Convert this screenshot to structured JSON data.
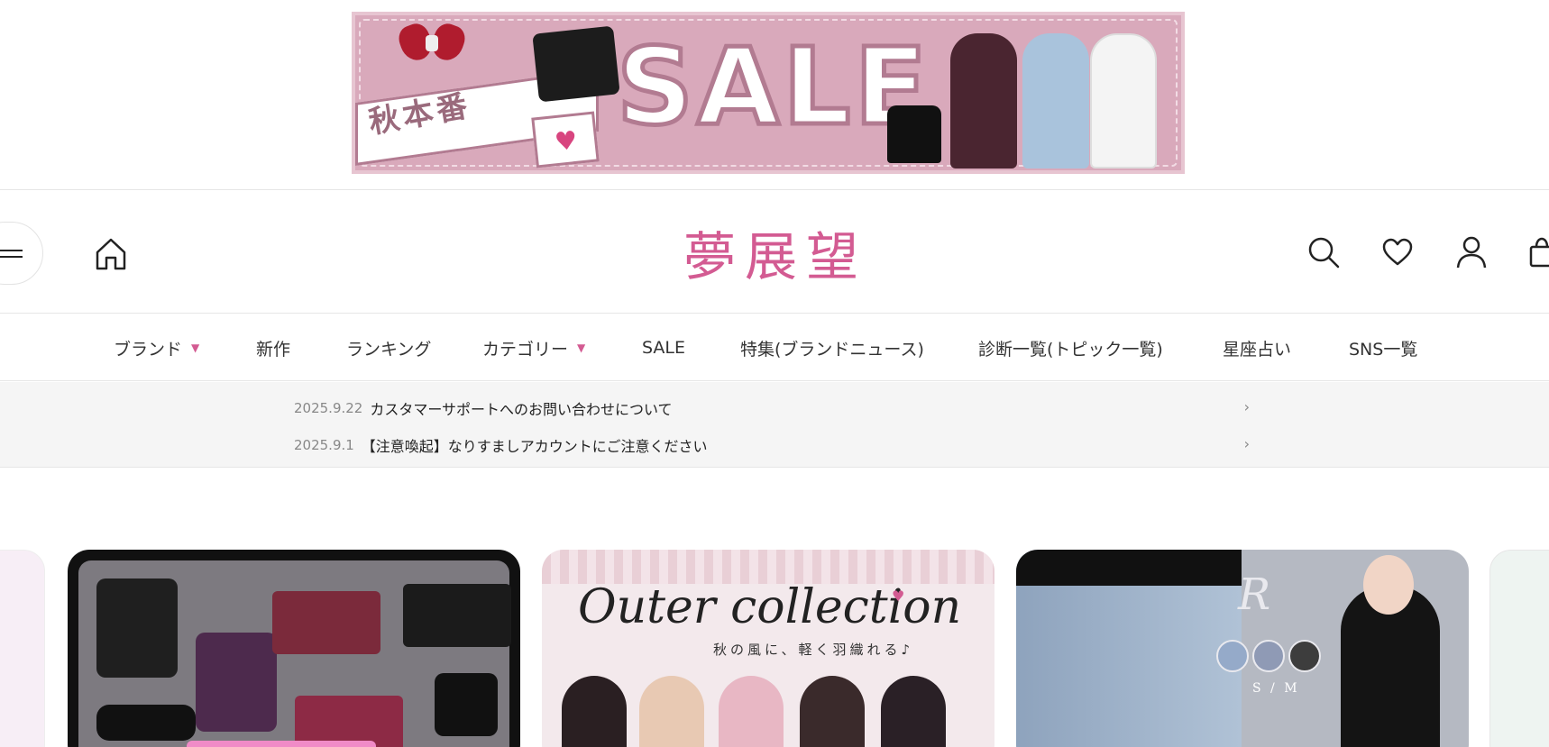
{
  "promo": {
    "tag_text": "秋本番",
    "sale_text": "SALE"
  },
  "header": {
    "logo_text": "夢展望",
    "icons": [
      "menu-icon",
      "home-icon",
      "search-icon",
      "heart-icon",
      "user-icon",
      "cart-icon"
    ]
  },
  "nav": {
    "items": [
      {
        "label": "ブランド",
        "has_dropdown": true
      },
      {
        "label": "新作",
        "has_dropdown": false
      },
      {
        "label": "ランキング",
        "has_dropdown": false
      },
      {
        "label": "カテゴリー",
        "has_dropdown": true
      },
      {
        "label": "SALE",
        "has_dropdown": false
      },
      {
        "label": "特集(ブランドニュース)",
        "has_dropdown": false
      },
      {
        "label": "診断一覧(トピック一覧)",
        "has_dropdown": false
      },
      {
        "label": "星座占い",
        "has_dropdown": false
      },
      {
        "label": "SNS一覧",
        "has_dropdown": false
      }
    ]
  },
  "news": {
    "items": [
      {
        "date": "2025.9.22",
        "title": "カスタマーサポートへのお問い合わせについて"
      },
      {
        "date": "2025.9.1",
        "title": "【注意喚起】なりすましアカウントにご注意ください"
      }
    ]
  },
  "carousel": {
    "card2": {
      "title": "Outer collection",
      "subtitle": "秋の風に、軽く羽織れる♪"
    },
    "card3": {
      "logo": "R",
      "size_label": "S / M"
    }
  },
  "colors": {
    "accent": "#d35b92",
    "promo_bg": "#d9a9bb"
  }
}
